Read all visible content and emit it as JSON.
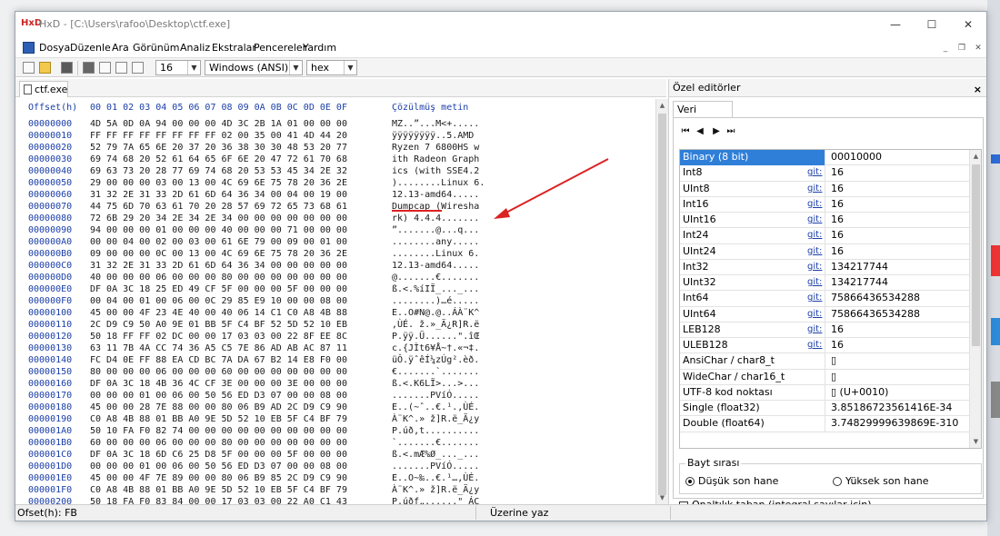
{
  "window": {
    "title": "HxD - [C:\\Users\\rafoo\\Desktop\\ctf.exe]",
    "app_icon": "HxD",
    "minimize": "—",
    "maximize": "☐",
    "close": "✕"
  },
  "menu": [
    "Dosya",
    "Düzenle",
    "Ara",
    "Görünüm",
    "Analiz",
    "Ekstralar",
    "Pencereler",
    "Yardım"
  ],
  "toolbar": {
    "bytes_per_row": "16",
    "charset": "Windows (ANSI)",
    "display": "hex"
  },
  "file_tab": "ctf.exe",
  "hex_header": {
    "offset_label": "Offset(h)",
    "columns": "00 01 02 03 04 05 06 07 08 09 0A 0B 0C 0D 0E 0F",
    "text_label": "Çözülmüş metin"
  },
  "hex_rows": [
    {
      "off": "00000000",
      "bytes": "4D 5A 0D 0A 94 00 00 00 4D 3C 2B 1A 01 00 00 00",
      "text": "MZ..”...M<+....."
    },
    {
      "off": "00000010",
      "bytes": "FF FF FF FF FF FF FF FF 02 00 35 00 41 4D 44 20",
      "text": "ÿÿÿÿÿÿÿÿ..5.AMD "
    },
    {
      "off": "00000020",
      "bytes": "52 79 7A 65 6E 20 37 20 36 38 30 30 48 53 20 77",
      "text": "Ryzen 7 6800HS w"
    },
    {
      "off": "00000030",
      "bytes": "69 74 68 20 52 61 64 65 6F 6E 20 47 72 61 70 68",
      "text": "ith Radeon Graph"
    },
    {
      "off": "00000040",
      "bytes": "69 63 73 20 28 77 69 74 68 20 53 53 45 34 2E 32",
      "text": "ics (with SSE4.2"
    },
    {
      "off": "00000050",
      "bytes": "29 00 00 00 03 00 13 00 4C 69 6E 75 78 20 36 2E",
      "text": ")........Linux 6."
    },
    {
      "off": "00000060",
      "bytes": "31 32 2E 31 33 2D 61 6D 64 36 34 00 04 00 19 00",
      "text": "12.13-amd64....."
    },
    {
      "off": "00000070",
      "bytes": "44 75 6D 70 63 61 70 20 28 57 69 72 65 73 68 61",
      "text": "Dumpcap (Wiresha"
    },
    {
      "off": "00000080",
      "bytes": "72 6B 29 20 34 2E 34 2E 34 00 00 00 00 00 00 00",
      "text": "rk) 4.4.4......."
    },
    {
      "off": "00000090",
      "bytes": "94 00 00 00 01 00 00 00 40 00 00 00 71 00 00 00",
      "text": "”.......@...q..."
    },
    {
      "off": "000000A0",
      "bytes": "00 00 04 00 02 00 03 00 61 6E 79 00 09 00 01 00",
      "text": "........any....."
    },
    {
      "off": "000000B0",
      "bytes": "09 00 00 00 0C 00 13 00 4C 69 6E 75 78 20 36 2E",
      "text": "........Linux 6."
    },
    {
      "off": "000000C0",
      "bytes": "31 32 2E 31 33 2D 61 6D 64 36 34 00 00 00 00 00",
      "text": "12.13-amd64....."
    },
    {
      "off": "000000D0",
      "bytes": "40 00 00 00 06 00 00 00 80 00 00 00 00 00 00 00",
      "text": "@.......€......."
    },
    {
      "off": "000000E0",
      "bytes": "DF 0A 3C 18 25 ED 49 CF 5F 00 00 00 5F 00 00 00",
      "text": "ß.<.%íIÏ_..._..."
    },
    {
      "off": "000000F0",
      "bytes": "00 04 00 01 00 06 00 0C 29 85 E9 10 00 00 08 00",
      "text": "........)…é....."
    },
    {
      "off": "00000100",
      "bytes": "45 00 00 4F 23 4E 40 00 40 06 14 C1 C0 A8 4B 88",
      "text": "E..O#N@.@..ÁÀ¨K^"
    },
    {
      "off": "00000110",
      "bytes": "2C D9 C9 50 A0 9E 01 BB 5F C4 BF 52 5D 52 10 EB",
      "text": ",ÙÉ. ž.»_Ä¿R]R.ë"
    },
    {
      "off": "00000120",
      "bytes": "50 18 FF FF 02 DC 00 00 17 03 03 00 22 8F EE 8C",
      "text": "P.ÿÿ.Ü......\".îŒ"
    },
    {
      "off": "00000130",
      "bytes": "63 11 7B 4A CC 74 36 A5 C5 7E 86 AD AB AC 87 11",
      "text": "c.{JÌt6¥Å~†.«¬‡."
    },
    {
      "off": "00000140",
      "bytes": "FC D4 0E FF 88 EA CD BC 7A DA 67 B2 14 E8 F0 00",
      "text": "üÔ.ÿˆêÍ¼zÚg².èð."
    },
    {
      "off": "00000150",
      "bytes": "80 00 00 00 06 00 00 00 60 00 00 00 00 00 00 00",
      "text": "€.......`......."
    },
    {
      "off": "00000160",
      "bytes": "DF 0A 3C 18 4B 36 4C CF 3E 00 00 00 3E 00 00 00",
      "text": "ß.<.K6LÏ>...>..."
    },
    {
      "off": "00000170",
      "bytes": "00 00 00 01 00 06 00 50 56 ED D3 07 00 00 08 00",
      "text": ".......PVíÓ....."
    },
    {
      "off": "00000180",
      "bytes": "45 00 00 28 7E 88 00 00 80 06 B9 AD 2C D9 C9 90",
      "text": "E..(~ˆ..€.¹.,ÙÉ."
    },
    {
      "off": "00000190",
      "bytes": "C0 A8 4B 88 01 BB A0 9E 5D 52 10 EB 5F C4 BF 79",
      "text": "À¨K^.» ž]R.ë_Ä¿y"
    },
    {
      "off": "000001A0",
      "bytes": "50 10 FA F0 82 74 00 00 00 00 00 00 00 00 00 00",
      "text": "P.úð‚t.........."
    },
    {
      "off": "000001B0",
      "bytes": "60 00 00 00 06 00 00 00 80 00 00 00 00 00 00 00",
      "text": "`.......€......."
    },
    {
      "off": "000001C0",
      "bytes": "DF 0A 3C 18 6D C6 25 D8 5F 00 00 00 5F 00 00 00",
      "text": "ß.<.mÆ%Ø_..._..."
    },
    {
      "off": "000001D0",
      "bytes": "00 00 00 01 00 06 00 50 56 ED D3 07 00 00 08 00",
      "text": ".......PVíÓ....."
    },
    {
      "off": "000001E0",
      "bytes": "45 00 00 4F 7E 89 00 00 80 06 B9 85 2C D9 C9 90",
      "text": "E..O~‰..€.¹…,ÙÉ."
    },
    {
      "off": "000001F0",
      "bytes": "C0 A8 4B 88 01 BB A0 9E 5D 52 10 EB 5F C4 BF 79",
      "text": "À¨K^.» ž]R.ë_Ä¿y"
    },
    {
      "off": "00000200",
      "bytes": "50 18 FA F0 83 84 00 00 17 03 03 00 22 A0 C1 43",
      "text": "P.úðƒ„......\" ÁC"
    }
  ],
  "side_panel": {
    "title": "Özel editörler",
    "close": "×",
    "tab": "Veri denetçisi",
    "nav": [
      "⏮",
      "◀",
      "▶",
      "⏭"
    ],
    "rows": [
      {
        "name": "Binary (8 bit)",
        "link": "",
        "value": "00010000",
        "selected": true
      },
      {
        "name": "Int8",
        "link": "git:",
        "value": "16"
      },
      {
        "name": "UInt8",
        "link": "git:",
        "value": "16"
      },
      {
        "name": "Int16",
        "link": "git:",
        "value": "16"
      },
      {
        "name": "UInt16",
        "link": "git:",
        "value": "16"
      },
      {
        "name": "Int24",
        "link": "git:",
        "value": "16"
      },
      {
        "name": "UInt24",
        "link": "git:",
        "value": "16"
      },
      {
        "name": "Int32",
        "link": "git:",
        "value": "134217744"
      },
      {
        "name": "UInt32",
        "link": "git:",
        "value": "134217744"
      },
      {
        "name": "Int64",
        "link": "git:",
        "value": "75866436534288"
      },
      {
        "name": "UInt64",
        "link": "git:",
        "value": "75866436534288"
      },
      {
        "name": "LEB128",
        "link": "git:",
        "value": "16"
      },
      {
        "name": "ULEB128",
        "link": "git:",
        "value": "16"
      },
      {
        "name": "AnsiChar / char8_t",
        "link": "",
        "value": "▯"
      },
      {
        "name": "WideChar / char16_t",
        "link": "",
        "value": "▯"
      },
      {
        "name": "UTF-8 kod noktası",
        "link": "",
        "value": "▯ (U+0010)"
      },
      {
        "name": "Single (float32)",
        "link": "",
        "value": "3.85186723561416E-34"
      },
      {
        "name": "Double (float64)",
        "link": "",
        "value": "3.74829999639869E-310"
      }
    ],
    "byte_order_title": "Bayt sırası",
    "little_endian": "Düşük son hane",
    "big_endian": "Yüksek son hane",
    "octal_label": "Onaltılık taban (integral sayılar için)"
  },
  "status": {
    "offset": "Ofset(h): FB",
    "mode": "Üzerine yaz"
  },
  "colors": {
    "offset_blue": "#1a3ea8",
    "selection": "#2f7fd8",
    "annotation_red": "#d22"
  }
}
